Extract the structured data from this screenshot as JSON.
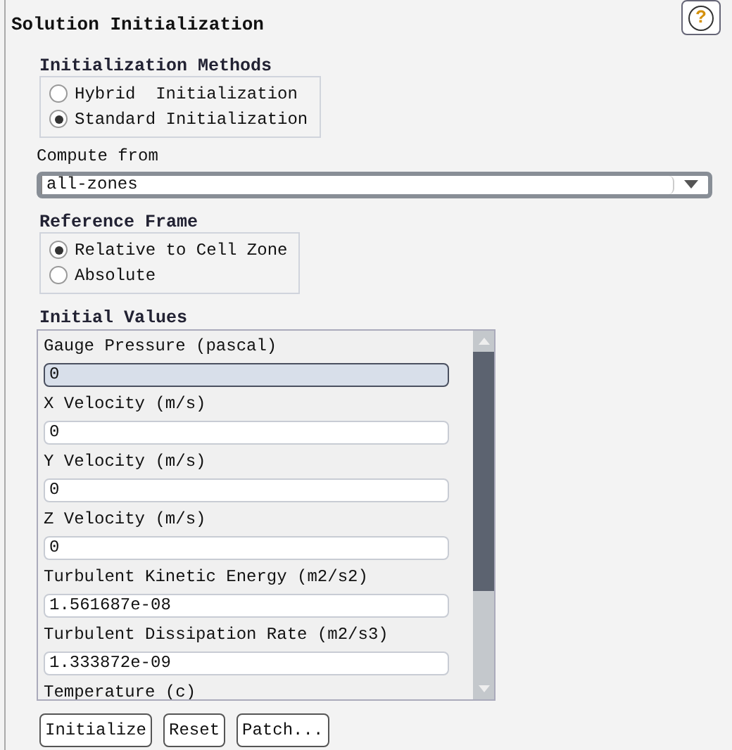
{
  "title": "Solution Initialization",
  "help_button": {
    "label": "?"
  },
  "initialization_methods": {
    "heading": "Initialization Methods",
    "options": [
      {
        "label": "Hybrid  Initialization",
        "selected": false
      },
      {
        "label": "Standard Initialization",
        "selected": true
      }
    ]
  },
  "compute_from": {
    "label": "Compute from",
    "value": "all-zones"
  },
  "reference_frame": {
    "heading": "Reference Frame",
    "options": [
      {
        "label": "Relative to Cell Zone",
        "selected": true
      },
      {
        "label": "Absolute",
        "selected": false
      }
    ]
  },
  "initial_values": {
    "heading": "Initial Values",
    "items": [
      {
        "label": "Gauge Pressure (pascal)",
        "value": "0",
        "focused": true
      },
      {
        "label": "X Velocity (m/s)",
        "value": "0",
        "focused": false
      },
      {
        "label": "Y Velocity (m/s)",
        "value": "0",
        "focused": false
      },
      {
        "label": "Z Velocity (m/s)",
        "value": "0",
        "focused": false
      },
      {
        "label": "Turbulent Kinetic Energy (m2/s2)",
        "value": "1.561687e-08",
        "focused": false
      },
      {
        "label": "Turbulent Dissipation Rate (m2/s3)",
        "value": "1.333872e-09",
        "focused": false
      },
      {
        "label": "Temperature (c)"
      }
    ]
  },
  "buttons": [
    "Initialize",
    "Reset",
    "Patch..."
  ]
}
